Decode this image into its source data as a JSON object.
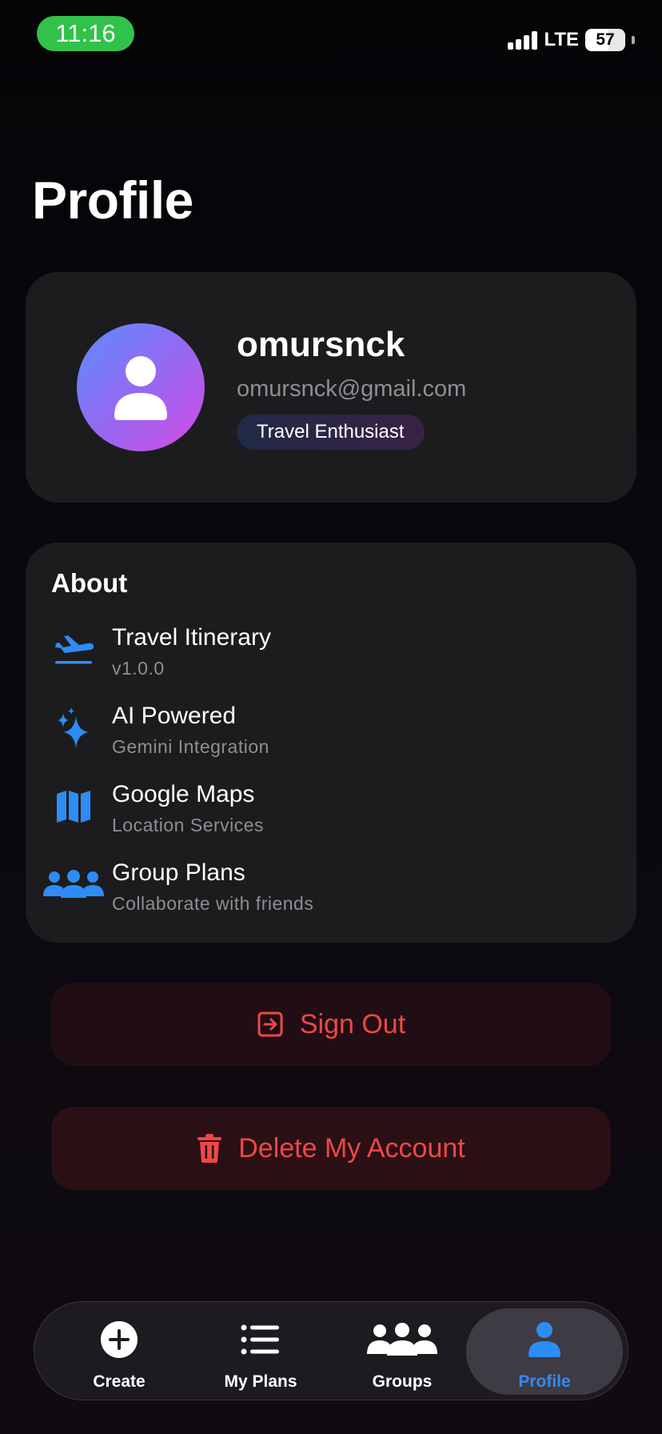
{
  "status": {
    "time": "11:16",
    "network": "LTE",
    "battery": "57"
  },
  "page": {
    "title": "Profile"
  },
  "profile": {
    "username": "omursnck",
    "email": "omursnck@gmail.com",
    "badge": "Travel Enthusiast"
  },
  "about": {
    "title": "About",
    "items": [
      {
        "label": "Travel Itinerary",
        "sub": "v1.0.0",
        "icon": "airplane-departure-icon"
      },
      {
        "label": "AI Powered",
        "sub": "Gemini Integration",
        "icon": "sparkles-icon"
      },
      {
        "label": "Google Maps",
        "sub": "Location Services",
        "icon": "map-icon"
      },
      {
        "label": "Group Plans",
        "sub": "Collaborate with friends",
        "icon": "people-group-icon"
      }
    ]
  },
  "actions": {
    "sign_out": "Sign Out",
    "delete_account": "Delete My Account"
  },
  "tabs": [
    {
      "label": "Create",
      "icon": "plus-circle-icon"
    },
    {
      "label": "My Plans",
      "icon": "list-icon"
    },
    {
      "label": "Groups",
      "icon": "people-group-icon"
    },
    {
      "label": "Profile",
      "icon": "person-icon",
      "active": true
    }
  ],
  "colors": {
    "accent": "#2e8cf5",
    "danger": "#f04747",
    "status_green": "#32c14a"
  }
}
